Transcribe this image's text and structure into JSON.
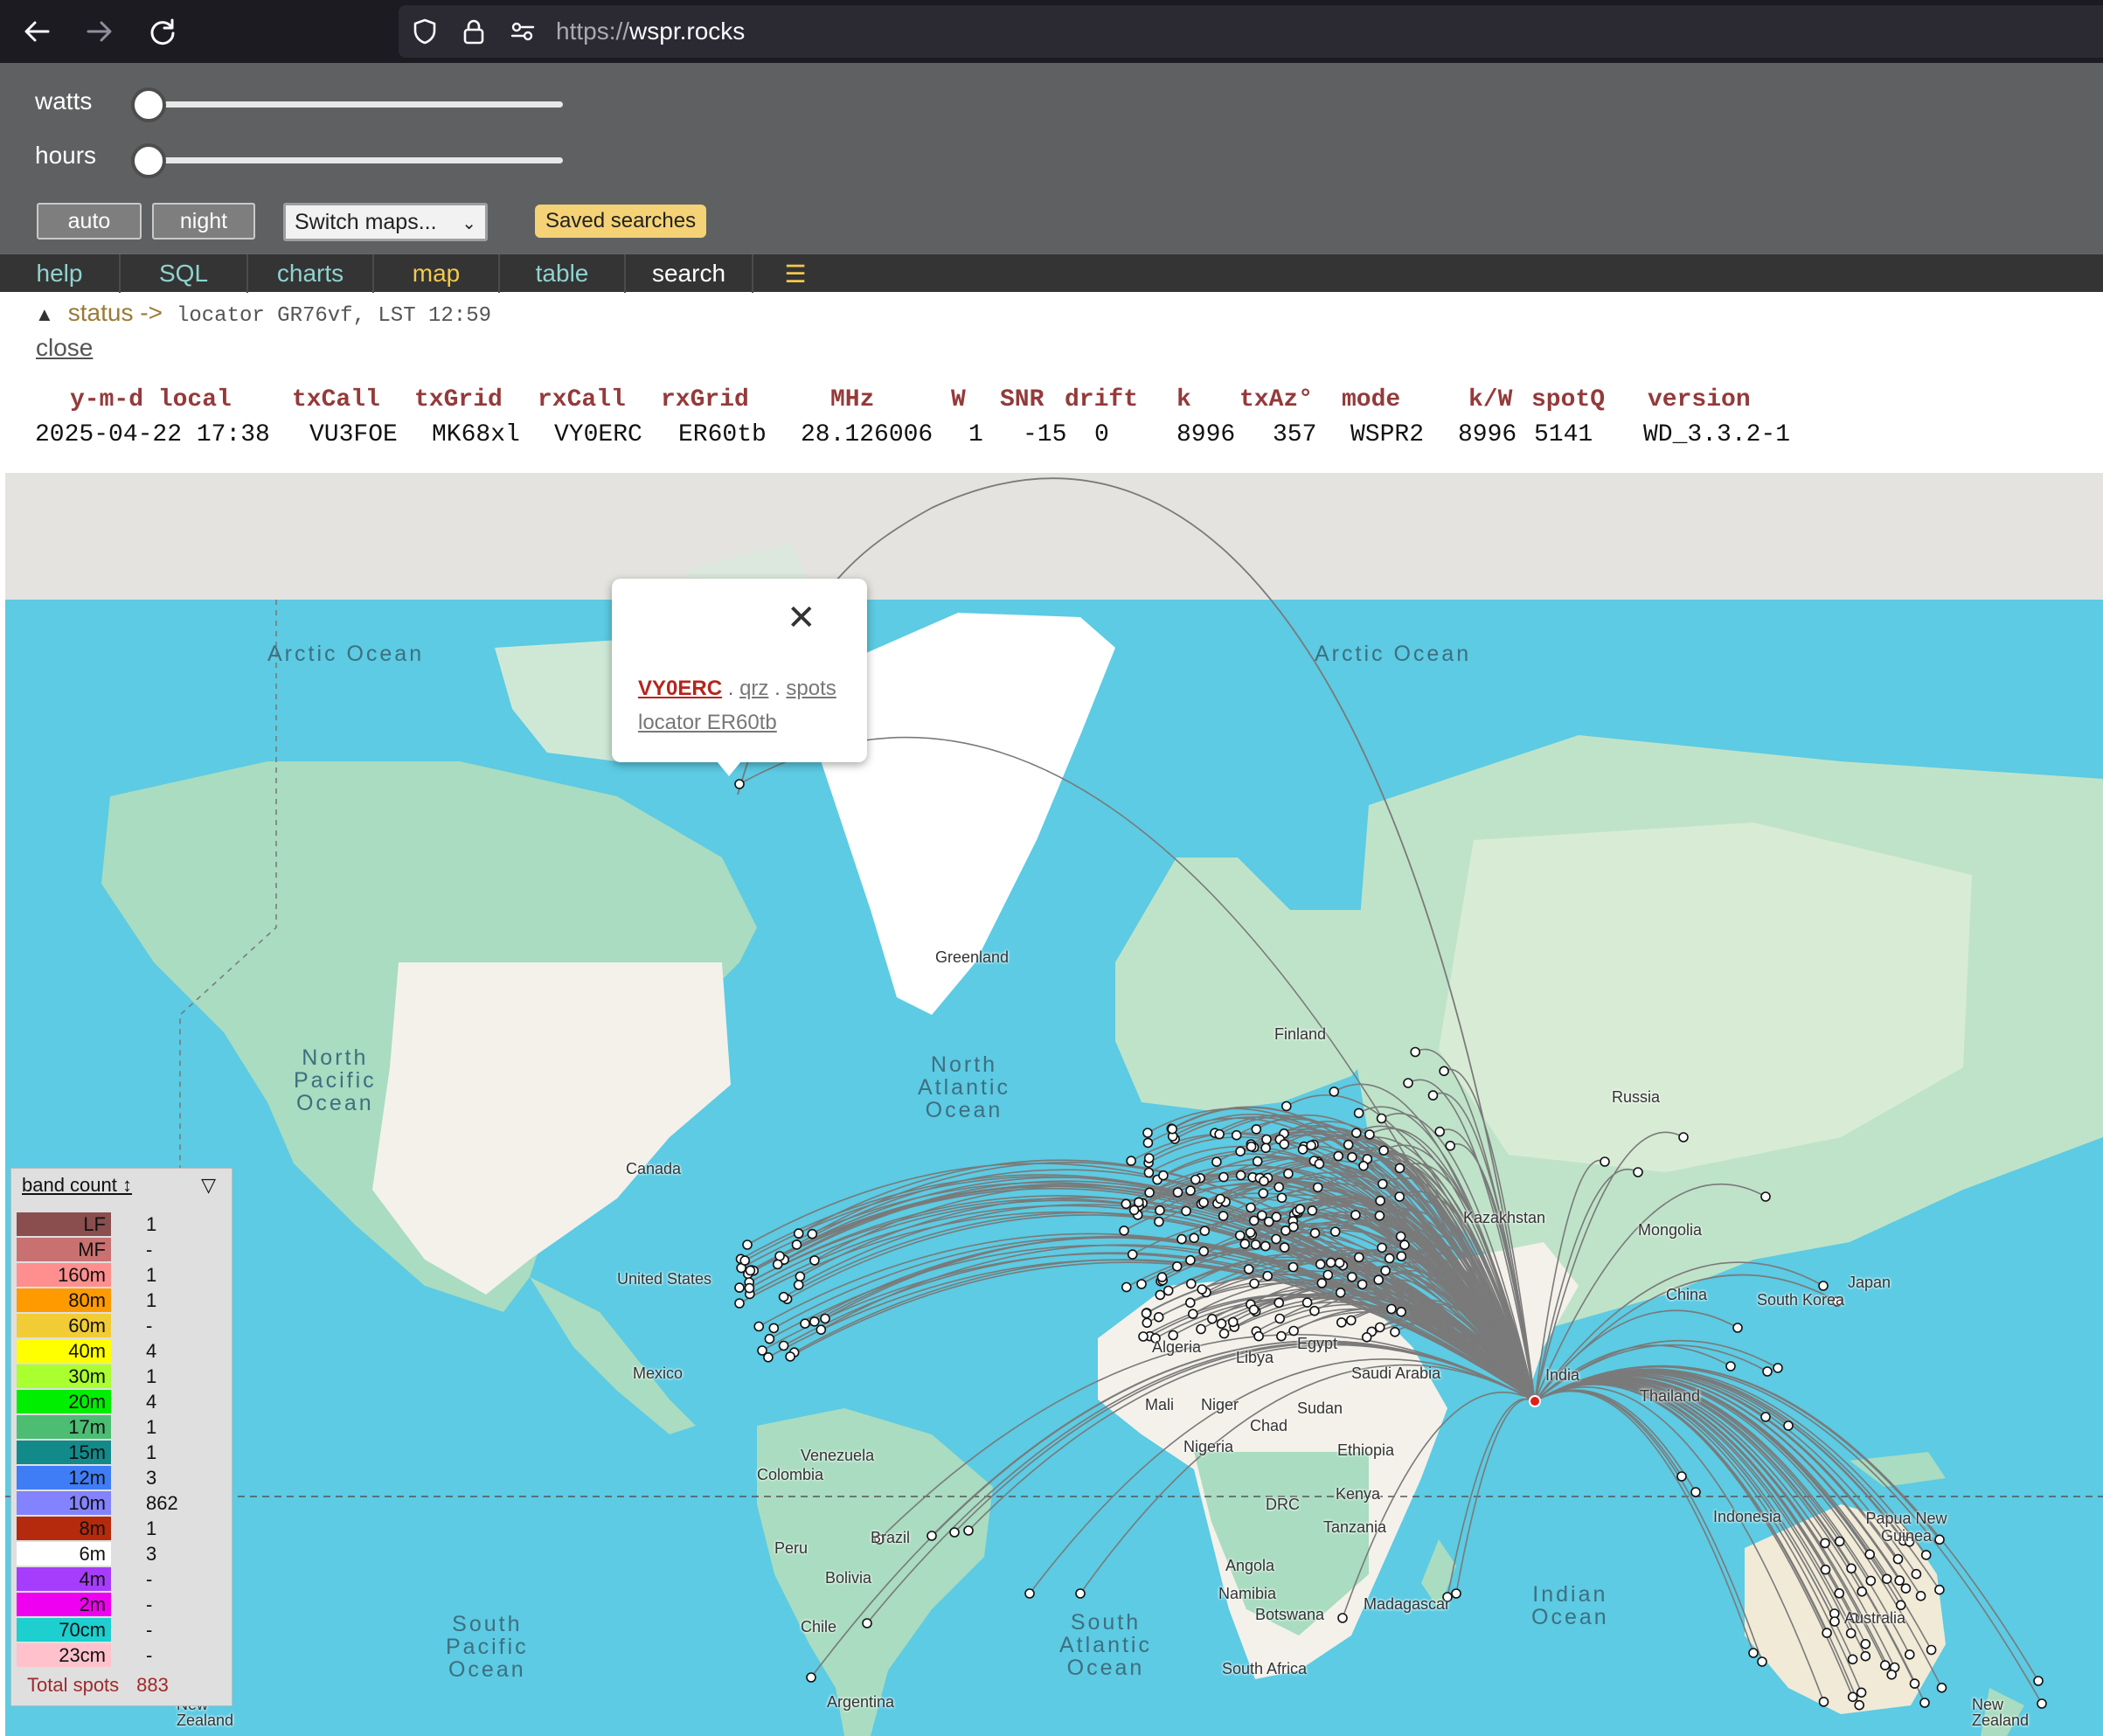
{
  "browser": {
    "url_scheme": "https://",
    "url_host": "wspr.rocks",
    "icons": [
      "back-icon",
      "forward-icon",
      "reload-icon",
      "shield-icon",
      "lock-icon",
      "permissions-icon"
    ]
  },
  "controls": {
    "watts_label": "watts",
    "hours_label": "hours",
    "auto_label": "auto",
    "night_label": "night",
    "switch_maps_label": "Switch maps...",
    "saved_searches_label": "Saved searches"
  },
  "menu": {
    "items": [
      {
        "label": "help",
        "color": "#8fd3cf"
      },
      {
        "label": "SQL",
        "color": "#8fd3cf"
      },
      {
        "label": "charts",
        "color": "#8fd3cf"
      },
      {
        "label": "map",
        "color": "#f2c94c"
      },
      {
        "label": "table",
        "color": "#8fd3cf"
      },
      {
        "label": "search",
        "color": "#ffffff"
      }
    ],
    "hamburger": "☰",
    "hamburger_color": "#f2c94c"
  },
  "status": {
    "label": "status ->",
    "info": "locator GR76vf, LST 12:59",
    "close_label": "close"
  },
  "spot": {
    "headers": [
      "y-m-d local",
      "txCall",
      "txGrid",
      "rxCall",
      "rxGrid",
      "MHz",
      "W",
      "SNR",
      "drift",
      "k",
      "txAz°",
      "mode",
      "k/W",
      "spotQ",
      "version"
    ],
    "row": [
      "2025-04-22 17:38",
      "VU3FOE",
      "MK68xl",
      "VY0ERC",
      "ER60tb",
      "28.126006",
      "1",
      "-15",
      "0",
      "8996",
      "357",
      "WSPR2",
      "8996",
      "5141",
      "WD_3.3.2-1"
    ]
  },
  "popup": {
    "call": "VY0ERC",
    "sep1": " . ",
    "qrz": "qrz",
    "sep2": " . ",
    "spots": "spots",
    "locator": "locator   ER60tb"
  },
  "map": {
    "ocean_labels": [
      "Arctic Ocean",
      "Arctic Ocean",
      "North\nPacific\nOcean",
      "North\nAtlantic\nOcean",
      "South\nPacific\nOcean",
      "South\nAtlantic\nOcean",
      "Indian\nOcean"
    ],
    "place_labels": [
      "Greenland",
      "Finland",
      "Russia",
      "Canada",
      "United States",
      "Mexico",
      "Kazakhstan",
      "Mongolia",
      "China",
      "Japan",
      "South Korea",
      "Algeria",
      "Libya",
      "Egypt",
      "Saudi Arabia",
      "Mali",
      "Niger",
      "Chad",
      "Sudan",
      "Nigeria",
      "Ethiopia",
      "India",
      "Thailand",
      "Venezuela",
      "Colombia",
      "Brazil",
      "Peru",
      "Bolivia",
      "Chile",
      "Argentina",
      "Kenya",
      "Tanzania",
      "DRC",
      "Angola",
      "Namibia",
      "Botswana",
      "South Africa",
      "Madagascar",
      "Indonesia",
      "Papua New Guinea",
      "Australia",
      "New Zealand",
      "New Zealand"
    ]
  },
  "legend": {
    "header": "band count ↕",
    "toggle": "▽",
    "rows": [
      {
        "band": "LF",
        "count": "1",
        "color": "#8a4e4e"
      },
      {
        "band": "MF",
        "count": "-",
        "color": "#c97171"
      },
      {
        "band": "160m",
        "count": "1",
        "color": "#ff8f8f"
      },
      {
        "band": "80m",
        "count": "1",
        "color": "#ff9a00"
      },
      {
        "band": "60m",
        "count": "-",
        "color": "#f2cc35"
      },
      {
        "band": "40m",
        "count": "4",
        "color": "#ffff00"
      },
      {
        "band": "30m",
        "count": "1",
        "color": "#aaff2f"
      },
      {
        "band": "20m",
        "count": "4",
        "color": "#00ee00"
      },
      {
        "band": "17m",
        "count": "1",
        "color": "#4cbd72"
      },
      {
        "band": "15m",
        "count": "1",
        "color": "#128a8a"
      },
      {
        "band": "12m",
        "count": "3",
        "color": "#3f7df7"
      },
      {
        "band": "10m",
        "count": "862",
        "color": "#8383ff"
      },
      {
        "band": "8m",
        "count": "1",
        "color": "#b52a0c"
      },
      {
        "band": "6m",
        "count": "3",
        "color": "#ffffff"
      },
      {
        "band": "4m",
        "count": "-",
        "color": "#a63dfc"
      },
      {
        "band": "2m",
        "count": "-",
        "color": "#f000f0"
      },
      {
        "band": "70cm",
        "count": "-",
        "color": "#1dcfcf"
      },
      {
        "band": "23cm",
        "count": "-",
        "color": "#ffc2cc"
      }
    ],
    "total_label": "Total spots",
    "total_value": "883"
  }
}
